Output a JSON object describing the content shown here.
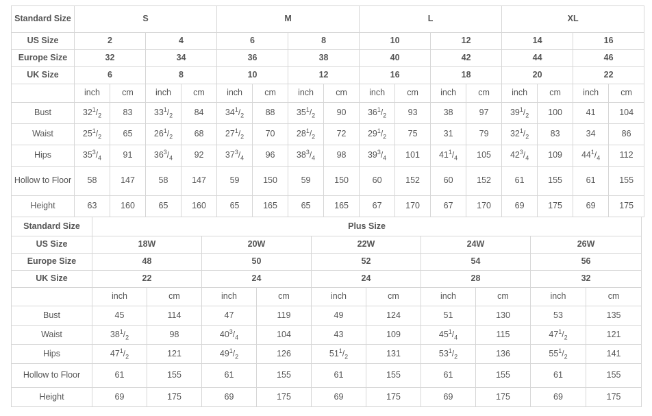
{
  "standard_table": {
    "row_labels": {
      "standard_size": "Standard Size",
      "us_size": "US Size",
      "europe_size": "Europe Size",
      "uk_size": "UK Size",
      "blank": "",
      "bust": "Bust",
      "waist": "Waist",
      "hips": "Hips",
      "hollow_to_floor": "Hollow to Floor",
      "height": "Height"
    },
    "size_groups": [
      {
        "label": "S",
        "span": 4
      },
      {
        "label": "M",
        "span": 4
      },
      {
        "label": "L",
        "span": 4
      },
      {
        "label": "XL",
        "span": 4
      }
    ],
    "us_sizes": [
      "2",
      "4",
      "6",
      "8",
      "10",
      "12",
      "14",
      "16"
    ],
    "europe_sizes": [
      "32",
      "34",
      "36",
      "38",
      "40",
      "42",
      "44",
      "46"
    ],
    "uk_sizes": [
      "6",
      "8",
      "10",
      "12",
      "16",
      "18",
      "20",
      "22"
    ],
    "units": [
      "inch",
      "cm",
      "inch",
      "cm",
      "inch",
      "cm",
      "inch",
      "cm",
      "inch",
      "cm",
      "inch",
      "cm",
      "inch",
      "cm",
      "inch",
      "cm"
    ],
    "measurements": [
      {
        "name": "Bust",
        "values": [
          "32 1/2",
          "83",
          "33 1/2",
          "84",
          "34 1/2",
          "88",
          "35 1/2",
          "90",
          "36 1/2",
          "93",
          "38",
          "97",
          "39 1/2",
          "100",
          "41",
          "104"
        ]
      },
      {
        "name": "Waist",
        "values": [
          "25 1/2",
          "65",
          "26 1/2",
          "68",
          "27 1/2",
          "70",
          "28 1/2",
          "72",
          "29 1/2",
          "75",
          "31",
          "79",
          "32 1/2",
          "83",
          "34",
          "86"
        ]
      },
      {
        "name": "Hips",
        "values": [
          "35 3/4",
          "91",
          "36 3/4",
          "92",
          "37 3/4",
          "96",
          "38 3/4",
          "98",
          "39 3/4",
          "101",
          "41 1/4",
          "105",
          "42 3/4",
          "109",
          "44 1/4",
          "112"
        ]
      },
      {
        "name": "Hollow to Floor",
        "values": [
          "58",
          "147",
          "58",
          "147",
          "59",
          "150",
          "59",
          "150",
          "60",
          "152",
          "60",
          "152",
          "61",
          "155",
          "61",
          "155"
        ]
      },
      {
        "name": "Height",
        "values": [
          "63",
          "160",
          "65",
          "160",
          "65",
          "165",
          "65",
          "165",
          "67",
          "170",
          "67",
          "170",
          "69",
          "175",
          "69",
          "175"
        ]
      }
    ]
  },
  "plus_table": {
    "row_labels": {
      "standard_size": "Standard Size",
      "us_size": "US Size",
      "europe_size": "Europe Size",
      "uk_size": "UK Size",
      "blank": "",
      "bust": "Bust",
      "waist": "Waist",
      "hips": "Hips",
      "hollow_to_floor": "Hollow to Floor",
      "height": "Height"
    },
    "group_label": "Plus Size",
    "us_sizes": [
      "18W",
      "20W",
      "22W",
      "24W",
      "26W"
    ],
    "europe_sizes": [
      "48",
      "50",
      "52",
      "54",
      "56"
    ],
    "uk_sizes": [
      "22",
      "24",
      "24",
      "28",
      "32"
    ],
    "units": [
      "inch",
      "cm",
      "inch",
      "cm",
      "inch",
      "cm",
      "inch",
      "cm",
      "inch",
      "cm"
    ],
    "measurements": [
      {
        "name": "Bust",
        "values": [
          "45",
          "114",
          "47",
          "119",
          "49",
          "124",
          "51",
          "130",
          "53",
          "135"
        ]
      },
      {
        "name": "Waist",
        "values": [
          "38 1/2",
          "98",
          "40 3/4",
          "104",
          "43",
          "109",
          "45 1/4",
          "115",
          "47 1/2",
          "121"
        ]
      },
      {
        "name": "Hips",
        "values": [
          "47 1/2",
          "121",
          "49 1/2",
          "126",
          "51 1/2",
          "131",
          "53 1/2",
          "136",
          "55 1/2",
          "141"
        ]
      },
      {
        "name": "Hollow to Floor",
        "values": [
          "61",
          "155",
          "61",
          "155",
          "61",
          "155",
          "61",
          "155",
          "61",
          "155"
        ]
      },
      {
        "name": "Height",
        "values": [
          "69",
          "175",
          "69",
          "175",
          "69",
          "175",
          "69",
          "175",
          "69",
          "175"
        ]
      }
    ]
  },
  "colors": {
    "header_bg": "#ededed",
    "border": "#d6d6d6",
    "body_text": "#555555",
    "header_text": "#1a1a1a"
  }
}
